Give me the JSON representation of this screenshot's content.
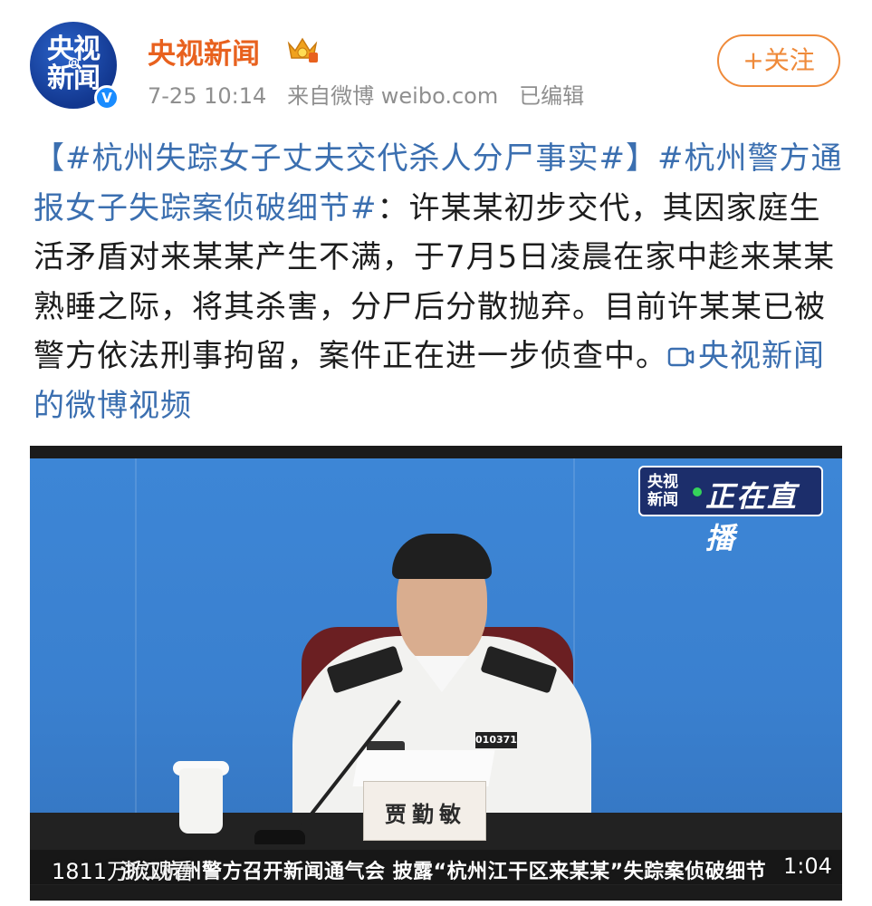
{
  "author": {
    "avatar_text_line1": "央视",
    "avatar_text_line2": "新闻",
    "avatar_at": "@",
    "name": "央视新闻",
    "verified_mark": "V",
    "crown_icon": "crown-icon",
    "verified_icon": "verified-badge-icon"
  },
  "meta": {
    "time": "7-25 10:14",
    "source": "来自微博 weibo.com",
    "edited": "已编辑"
  },
  "follow_label": "+关注",
  "post": {
    "tag1": "【#杭州失踪女子丈夫交代杀人分尸事实#】",
    "tag2": "#杭州警方通报女子失踪案侦破细节#",
    "body": "：许某某初步交代，其因家庭生活矛盾对来某某产生不满，于7月5日凌晨在家中趁来某某熟睡之际，将其杀害，分尸后分散抛弃。目前许某某已被警方依法刑事拘留，案件正在进一步侦查中。",
    "video_link": "央视新闻的微博视频",
    "video_link_icon": "video-link-icon"
  },
  "video": {
    "live_logo_line1": "央视",
    "live_logo_line2": "新闻",
    "live_label": "正在直播",
    "badge_number": "010371",
    "nameplate": "贾勤敏",
    "caption": "浙江杭州警方召开新闻通气会  披露“杭州江干区来某某”失踪案侦破细节",
    "views": "1811万次观看",
    "duration": "1:04"
  },
  "colors": {
    "author": "#e8611e",
    "link": "#3b6fb0",
    "follow": "#ef8a3a",
    "meta": "#8f8f8f"
  }
}
